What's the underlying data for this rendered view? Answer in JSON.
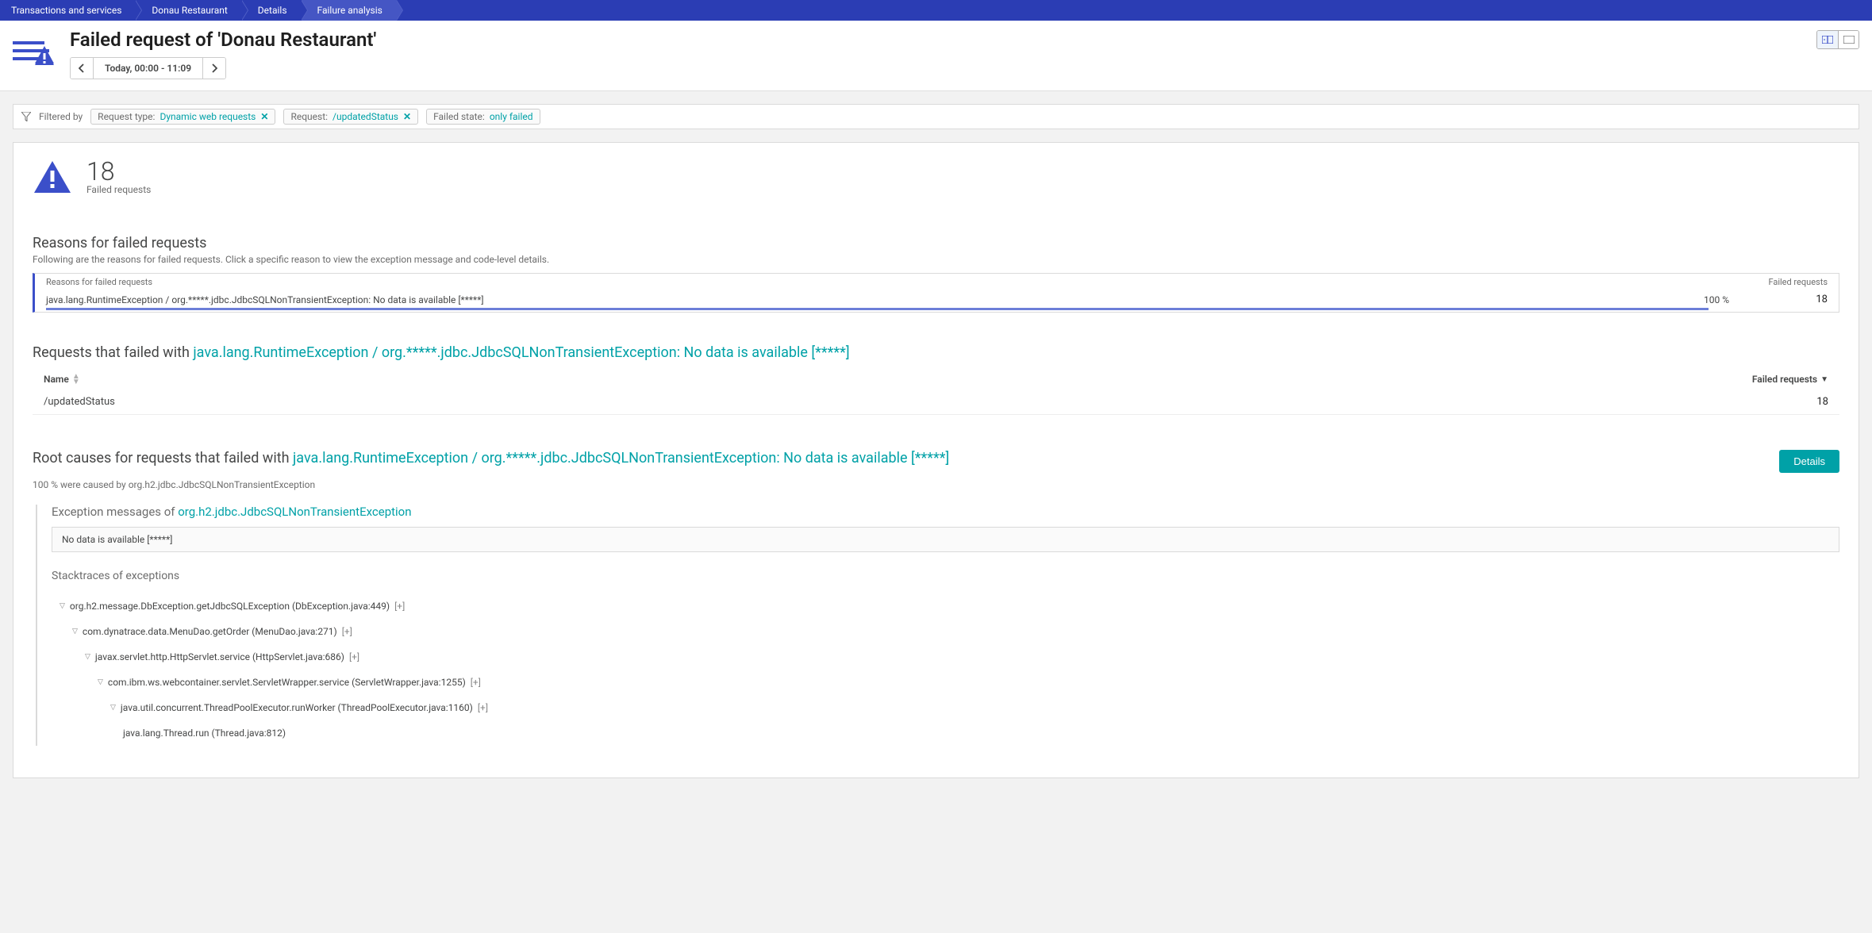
{
  "breadcrumb": [
    "Transactions and services",
    "Donau Restaurant",
    "Details",
    "Failure analysis"
  ],
  "header": {
    "title": "Failed request of 'Donau Restaurant'",
    "time_label": "Today, 00:00 - 11:09"
  },
  "filter_bar": {
    "label": "Filtered by",
    "chips": {
      "request_type_label": "Request type:",
      "request_type_value": "Dynamic web requests",
      "request_label": "Request:",
      "request_value": "/updatedStatus",
      "failed_state_label": "Failed state:",
      "failed_state_value": "only failed"
    }
  },
  "metric": {
    "count": "18",
    "label": "Failed requests"
  },
  "reasons": {
    "title": "Reasons for failed requests",
    "subtitle": "Following are the reasons for failed requests. Click a specific reason to view the exception message and code-level details.",
    "header_col1": "Reasons for failed requests",
    "header_col2": "Failed requests",
    "row": {
      "label": "java.lang.RuntimeException / org.*****.jdbc.JdbcSQLNonTransientException: No data is available [*****]",
      "pct": "100 %",
      "count": "18"
    }
  },
  "requests": {
    "title_prefix": "Requests that failed with ",
    "title_link": "java.lang.RuntimeException / org.*****.jdbc.JdbcSQLNonTransientException: No data is available [*****]",
    "col_name": "Name",
    "col_failed": "Failed requests",
    "row": {
      "name": "/updatedStatus",
      "count": "18"
    }
  },
  "rootcause": {
    "title_prefix": "Root causes for requests that failed with ",
    "title_link": "java.lang.RuntimeException / org.*****.jdbc.JdbcSQLNonTransientException: No data is available [*****]",
    "details_btn": "Details",
    "subtitle": "100 % were caused by org.h2.jdbc.JdbcSQLNonTransientException",
    "exception_title_prefix": "Exception messages of ",
    "exception_title_link": "org.h2.jdbc.JdbcSQLNonTransientException",
    "exception_msg": "No data is available [*****]",
    "stacktrace_title": "Stacktraces of exceptions",
    "stack": [
      "org.h2.message.DbException.getJdbcSQLException (DbException.java:449)",
      "com.dynatrace.data.MenuDao.getOrder (MenuDao.java:271)",
      "javax.servlet.http.HttpServlet.service (HttpServlet.java:686)",
      "com.ibm.ws.webcontainer.servlet.ServletWrapper.service (ServletWrapper.java:1255)",
      "java.util.concurrent.ThreadPoolExecutor.runWorker (ThreadPoolExecutor.java:1160)",
      "java.lang.Thread.run (Thread.java:812)"
    ],
    "expand": "[+]"
  }
}
